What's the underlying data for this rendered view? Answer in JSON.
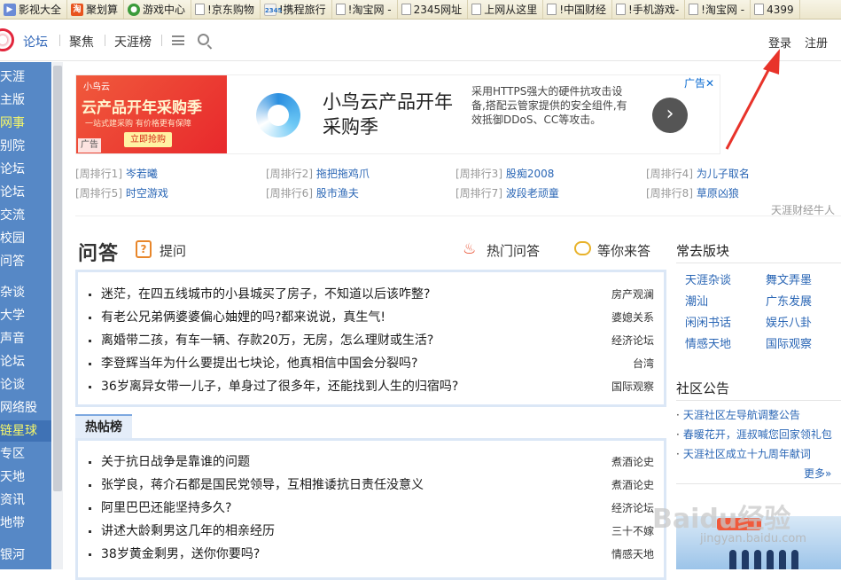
{
  "bookmarks": [
    {
      "label": "影视大全",
      "icon": "video-icon"
    },
    {
      "label": "聚划算",
      "icon": "taobao-icon"
    },
    {
      "label": "游戏中心",
      "icon": "game-icon"
    },
    {
      "label": "!京东购物",
      "icon": "page-icon"
    },
    {
      "label": "!携程旅行",
      "icon": "2345-icon"
    },
    {
      "label": "!淘宝网 -",
      "icon": "page-icon"
    },
    {
      "label": "2345网址",
      "icon": "page-icon"
    },
    {
      "label": "上网从这里",
      "icon": "page-icon"
    },
    {
      "label": "!中国财经",
      "icon": "page-icon"
    },
    {
      "label": "!手机游戏-",
      "icon": "page-icon"
    },
    {
      "label": "!淘宝网 -",
      "icon": "page-icon"
    },
    {
      "label": "4399",
      "icon": "page-icon"
    }
  ],
  "bookmark_badges": {
    "taobao": "淘",
    "2345": "2345"
  },
  "nav": {
    "forum": "论坛",
    "focus": "聚焦",
    "rank": "天涯榜",
    "login": "登录",
    "register": "注册"
  },
  "sidebar": [
    {
      "label": "天涯"
    },
    {
      "label": "主版"
    },
    {
      "label": "网事"
    },
    {
      "label": "别院"
    },
    {
      "label": "论坛"
    },
    {
      "label": "论坛"
    },
    {
      "label": "交流"
    },
    {
      "label": "校园"
    },
    {
      "label": "问答"
    },
    {
      "label": "杂谈"
    },
    {
      "label": "大学"
    },
    {
      "label": "声音"
    },
    {
      "label": "论坛"
    },
    {
      "label": "论谈"
    },
    {
      "label": "网络股"
    },
    {
      "label": "链星球"
    },
    {
      "label": "专区"
    },
    {
      "label": "天地"
    },
    {
      "label": "资讯"
    },
    {
      "label": "地带"
    },
    {
      "label": "银河"
    }
  ],
  "ad": {
    "brand": "小鸟云",
    "promo": "云产品开年采购季",
    "promo_sub": "一站式建采购  有价格更有保障",
    "buy": "立即抢购",
    "badge": "广告",
    "headline": "小鸟云产品开年采购季",
    "description": "采用HTTPS强大的硬件抗攻击设备,搭配云管家提供的安全组件,有效抵御DDoS、CC等攻击。",
    "arrow": "›",
    "corner": "广告✕"
  },
  "rankings": [
    {
      "tag": "[周排行1]",
      "text": "岑若曦"
    },
    {
      "tag": "[周排行2]",
      "text": "拖把拖鸡爪"
    },
    {
      "tag": "[周排行3]",
      "text": "股痴2008"
    },
    {
      "tag": "[周排行4]",
      "text": "为儿子取名"
    },
    {
      "tag": "[周排行5]",
      "text": "时空游戏"
    },
    {
      "tag": "[周排行6]",
      "text": "股市渔夫"
    },
    {
      "tag": "[周排行7]",
      "text": "波段老顽童"
    },
    {
      "tag": "[周排行8]",
      "text": "草原凶狼"
    }
  ],
  "rankings_caption": "天涯财经牛人",
  "qa": {
    "title": "问答",
    "ask": "提问",
    "ask_icon": "?",
    "hot": "热门问答",
    "fire_icon": "♨",
    "waiting": "等你来答",
    "items": [
      {
        "title": "迷茫，在四五线城市的小县城买了房子，不知道以后该咋整?",
        "cat": "房产观澜"
      },
      {
        "title": "有老公兄弟俩婆婆偏心妯娌的吗?都来说说，真生气!",
        "cat": "婆媳关系"
      },
      {
        "title": "离婚带二孩，有车一辆、存款20万，无房，怎么理财或生活?",
        "cat": "经济论坛"
      },
      {
        "title": "李登辉当年为什么要提出七块论，他真相信中国会分裂吗?",
        "cat": "台湾"
      },
      {
        "title": "36岁离异女带一儿子，单身过了很多年，还能找到人生的归宿吗?",
        "cat": "国际观察"
      }
    ]
  },
  "hot_posts": {
    "tab": "热帖榜",
    "items": [
      {
        "title": "关于抗日战争是靠谁的问题",
        "cat": "煮酒论史"
      },
      {
        "title": "张学良，蒋介石都是国民党领导，互相推诿抗日责任没意义",
        "cat": "煮酒论史"
      },
      {
        "title": "阿里巴巴还能坚持多久?",
        "cat": "经济论坛"
      },
      {
        "title": "讲述大龄剩男这几年的相亲经历",
        "cat": "三十不嫁"
      },
      {
        "title": "38岁黄金剩男，送你你要吗?",
        "cat": "情感天地"
      }
    ]
  },
  "favorites": {
    "title": "常去版块",
    "items": [
      "天涯杂谈",
      "舞文弄墨",
      "潮汕",
      "广东发展",
      "闲闲书话",
      "娱乐八卦",
      "情感天地",
      "国际观察"
    ]
  },
  "notices": {
    "title": "社区公告",
    "items": [
      "天涯社区左导航调整公告",
      "春暖花开，涯叔喊您回家领礼包",
      "天涯社区成立十九周年献词"
    ],
    "more": "更多»"
  },
  "watermark": {
    "text": "Baidu经验",
    "url": "jingyan.baidu.com"
  },
  "colors": {
    "sidebar": "#5688c6",
    "link": "#2a66b5",
    "annotation": "#e8332a",
    "box_border": "#dbe7f6"
  }
}
